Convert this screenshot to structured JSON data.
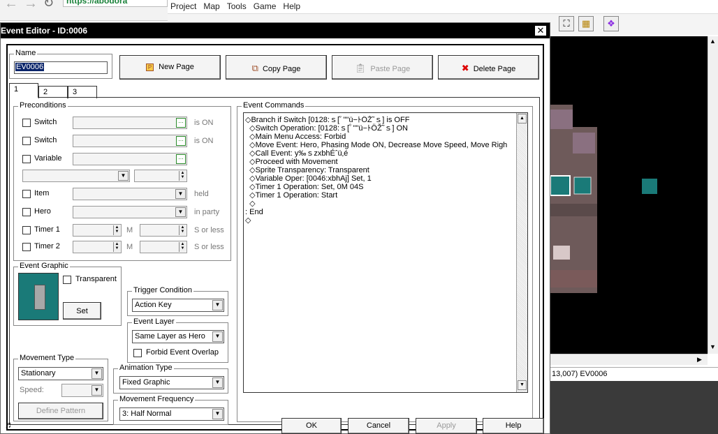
{
  "browser": {
    "url": "https://abodora"
  },
  "app_menu": [
    "Project",
    "Map",
    "Tools",
    "Game",
    "Help"
  ],
  "map_status": "13,007) EV0006",
  "dialog": {
    "title": "Event Editor - ID:0006",
    "close_glyph": "✕",
    "name_label": "Name",
    "name_value": "EV0006",
    "page_buttons": {
      "new": "New Page",
      "copy": "Copy Page",
      "paste": "Paste Page",
      "delete": "Delete Page"
    },
    "tabs": [
      "1",
      "2",
      "3"
    ],
    "preconditions": {
      "label": "Preconditions",
      "switch1": "Switch",
      "switch2": "Switch",
      "variable": "Variable",
      "is_on": "is ON",
      "dots": "...",
      "item": "Item",
      "held": "held",
      "hero": "Hero",
      "in_party": "in party",
      "timer1": "Timer 1",
      "timer2": "Timer 2",
      "m": "M",
      "s_or_less": "S or less"
    },
    "event_graphic": {
      "label": "Event Graphic",
      "transparent": "Transparent",
      "set": "Set"
    },
    "trigger": {
      "label": "Trigger Condition",
      "value": "Action Key"
    },
    "layer": {
      "label": "Event Layer",
      "value": "Same Layer as Hero",
      "forbid": "Forbid Event Overlap"
    },
    "movement_type": {
      "label": "Movement Type",
      "value": "Stationary",
      "speed": "Speed:",
      "define": "Define Pattern"
    },
    "animation": {
      "label": "Animation Type",
      "value": "Fixed Graphic"
    },
    "frequency": {
      "label": "Movement Frequency",
      "value": "3: Half Normal"
    },
    "commands": {
      "label": "Event Commands",
      "lines": [
        "◇Branch if  Switch [0128:ｓ[ﾟ\"\"ü−ﾄÖŽ˜ｓ] is OFF",
        "  ◇Switch Operation: [0128:ｓ[ﾟ\"\"ü−ﾄÖŽ˜ｓ] ON",
        "  ◇Main Menu Access: Forbid",
        "  ◇Move Event: Hero, Phasing Mode ON, Decrease Move Speed, Move Righ",
        "  ◇Call Event: y‰ｓzxbhÉˆü‚é",
        "  ◇Proceed with Movement",
        "  ◇Sprite Transparency: Transparent",
        "  ◇Variable Oper: [0046:xbhAj] Set, 1",
        "  ◇Timer 1 Operation: Set, 0M 04S",
        "  ◇Timer 1 Operation: Start",
        "  ◇",
        ": End",
        "◇"
      ]
    },
    "footer": {
      "ok": "OK",
      "cancel": "Cancel",
      "apply": "Apply",
      "help": "Help",
      "music_icon": "♬"
    }
  },
  "colors": {
    "titlebar": "#000000",
    "teal_marker": "#1a7a78",
    "selection": "#0a246a"
  }
}
